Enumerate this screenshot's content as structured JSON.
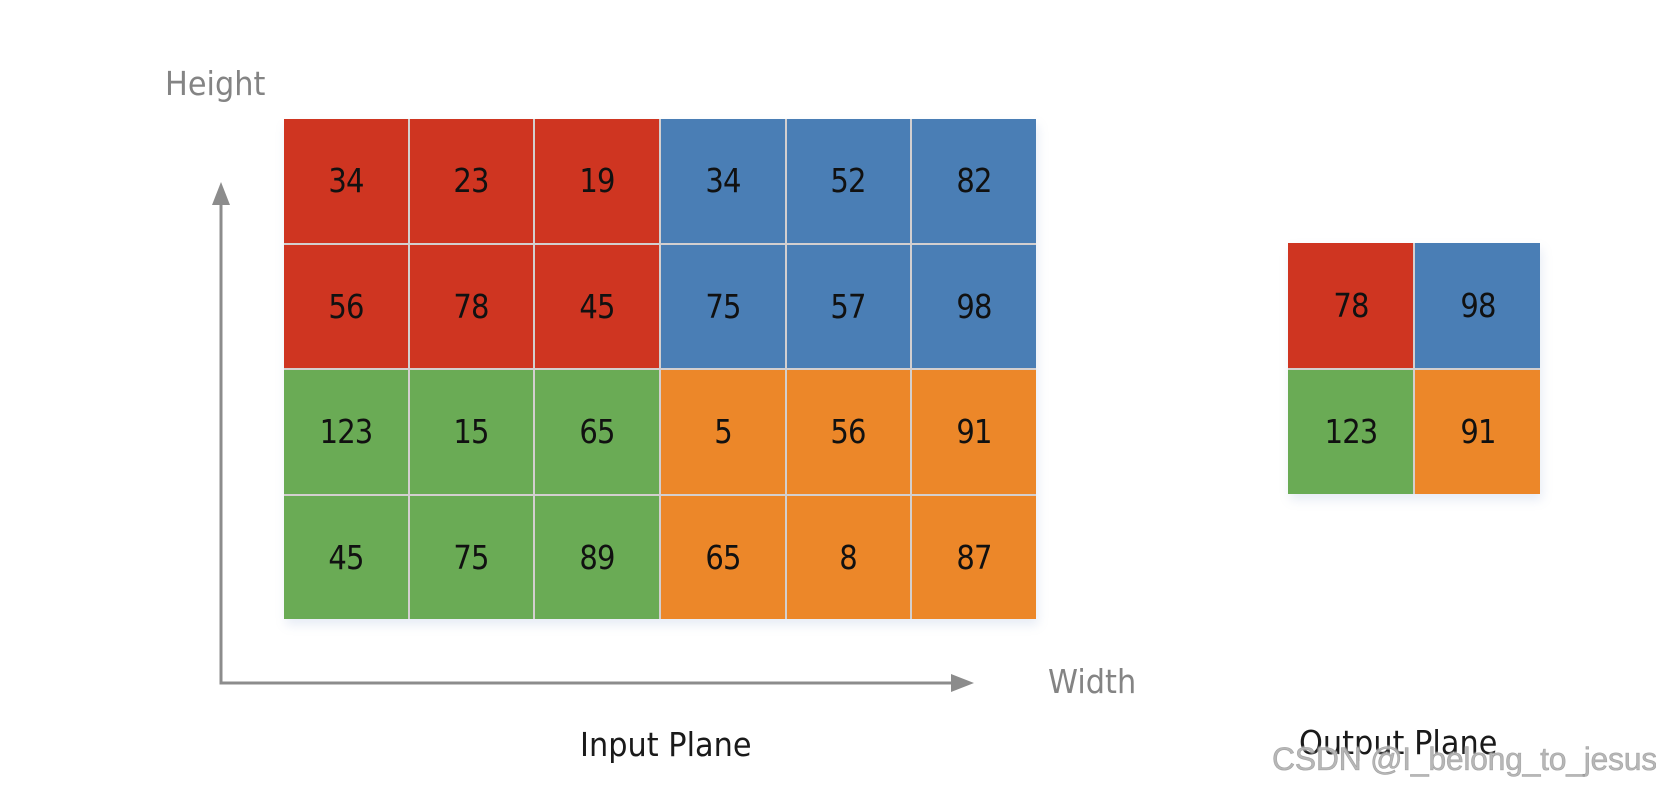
{
  "colors": {
    "red": "#CF3521",
    "blue": "#4A7EB5",
    "green": "#6AAB55",
    "orange": "#EC8729",
    "axis": "#8C8C8C",
    "axis_label": "#848484",
    "grid_line": "#D3CFCF"
  },
  "axes": {
    "y_label": "Height",
    "x_label": "Width"
  },
  "input_plane": {
    "label": "Input Plane",
    "rows": [
      [
        {
          "value": "34",
          "color": "red"
        },
        {
          "value": "23",
          "color": "red"
        },
        {
          "value": "19",
          "color": "red"
        },
        {
          "value": "34",
          "color": "blue"
        },
        {
          "value": "52",
          "color": "blue"
        },
        {
          "value": "82",
          "color": "blue"
        }
      ],
      [
        {
          "value": "56",
          "color": "red"
        },
        {
          "value": "78",
          "color": "red"
        },
        {
          "value": "45",
          "color": "red"
        },
        {
          "value": "75",
          "color": "blue"
        },
        {
          "value": "57",
          "color": "blue"
        },
        {
          "value": "98",
          "color": "blue"
        }
      ],
      [
        {
          "value": "123",
          "color": "green"
        },
        {
          "value": "15",
          "color": "green"
        },
        {
          "value": "65",
          "color": "green"
        },
        {
          "value": "5",
          "color": "orange"
        },
        {
          "value": "56",
          "color": "orange"
        },
        {
          "value": "91",
          "color": "orange"
        }
      ],
      [
        {
          "value": "45",
          "color": "green"
        },
        {
          "value": "75",
          "color": "green"
        },
        {
          "value": "89",
          "color": "green"
        },
        {
          "value": "65",
          "color": "orange"
        },
        {
          "value": "8",
          "color": "orange"
        },
        {
          "value": "87",
          "color": "orange"
        }
      ]
    ]
  },
  "output_plane": {
    "label": "Output Plane",
    "rows": [
      [
        {
          "value": "78",
          "color": "red"
        },
        {
          "value": "98",
          "color": "blue"
        }
      ],
      [
        {
          "value": "123",
          "color": "green"
        },
        {
          "value": "91",
          "color": "orange"
        }
      ]
    ]
  },
  "watermark": "CSDN @I_belong_to_jesus"
}
